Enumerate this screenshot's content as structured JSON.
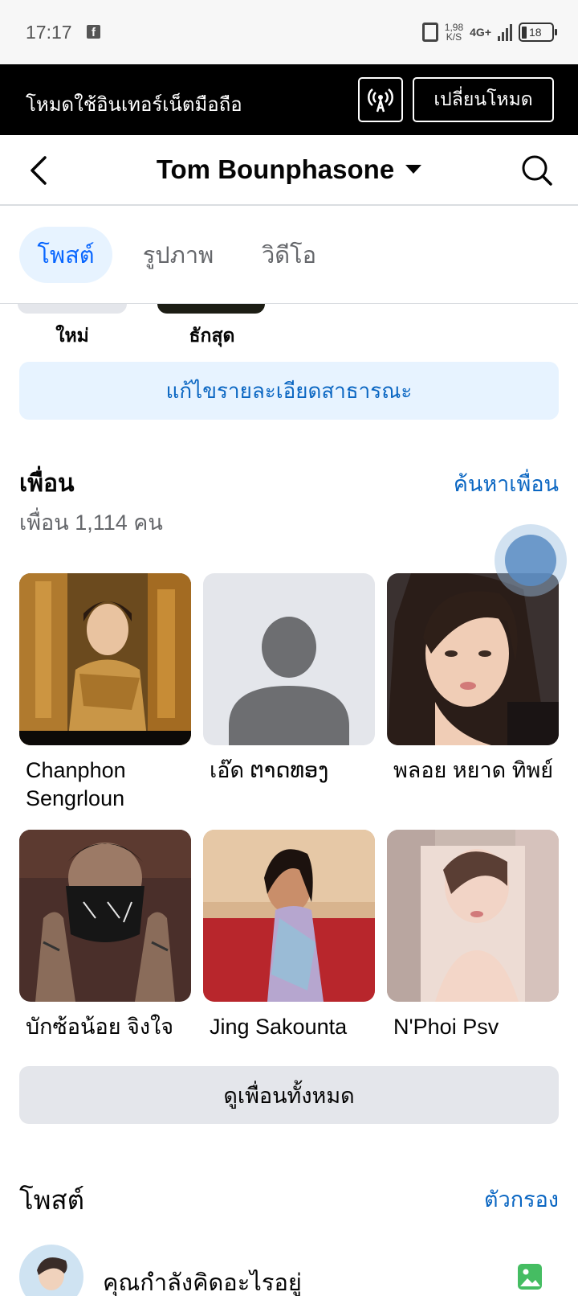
{
  "status_bar": {
    "time": "17:17",
    "app_icon": "facebook-icon",
    "speed_value": "1,98",
    "speed_unit": "K/S",
    "network": "4G+",
    "battery": "18"
  },
  "banner": {
    "text": "โหมดใช้อินเทอร์เน็ตมือถือ",
    "icon": "broadcast-icon",
    "switch_label": "เปลี่ยนโหมด"
  },
  "header": {
    "title": "Tom Bounphasone",
    "back_icon": "chevron-left-icon",
    "search_icon": "search-icon"
  },
  "tabs": [
    {
      "label": "โพสต์",
      "active": true
    },
    {
      "label": "รูปภาพ",
      "active": false
    },
    {
      "label": "วิดีโอ",
      "active": false
    }
  ],
  "highlights": [
    {
      "label": "ใหม่"
    },
    {
      "label": "ธักสุด"
    }
  ],
  "edit_public_label": "แก้ไขรายละเอียดสาธารณะ",
  "friends": {
    "title": "เพื่อน",
    "find_label": "ค้นหาเพื่อน",
    "count_label": "เพื่อน 1,114 คน",
    "items": [
      {
        "name": "Chanphon Sengrloun"
      },
      {
        "name": "เอ๊ด ຕາດທອງ"
      },
      {
        "name": "พลอย หยาด ทิพย์"
      },
      {
        "name": "บักซ้อน้อย จิงใจ"
      },
      {
        "name": "Jing Sakounta"
      },
      {
        "name": "N'Phoi Psv"
      }
    ],
    "see_all_label": "ดูเพื่อนทั้งหมด"
  },
  "posts": {
    "title": "โพสต์",
    "filter_label": "ตัวกรอง",
    "composer_placeholder": "คุณกำลังคิดอะไรอยู่",
    "photo_icon": "photo-icon"
  },
  "colors": {
    "accent": "#0866ff",
    "link": "#0a66c2",
    "tab_active_bg": "#e7f3ff",
    "button_bg": "#e4e6eb"
  }
}
